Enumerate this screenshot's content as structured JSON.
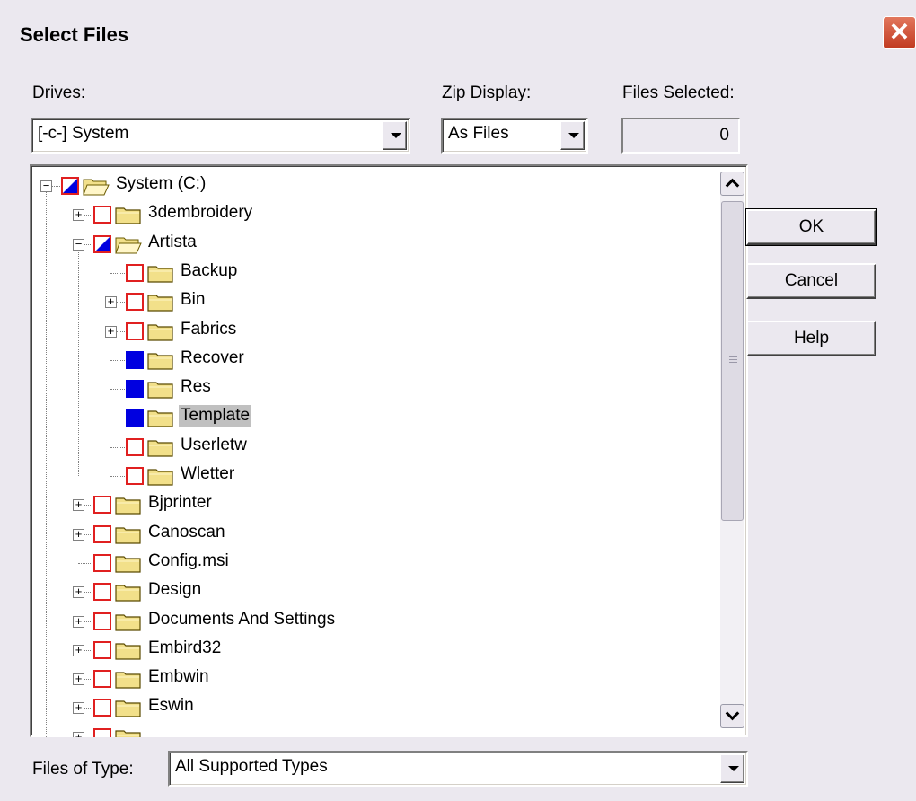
{
  "window": {
    "title": "Select Files",
    "close_glyph": "✕"
  },
  "drives": {
    "label": "Drives:",
    "value": "[-c-] System"
  },
  "zip_display": {
    "label": "Zip Display:",
    "value": "As Files"
  },
  "files_selected": {
    "label": "Files Selected:",
    "value": "0"
  },
  "buttons": {
    "ok": "OK",
    "cancel": "Cancel",
    "help": "Help"
  },
  "files_of_type": {
    "label": "Files of Type:",
    "value": "All Supported Types"
  },
  "tree": {
    "items": [
      {
        "label": "System (C:)",
        "level": 0,
        "expander": "minus",
        "check": "partial",
        "folder": "open"
      },
      {
        "label": "3dembroidery",
        "level": 1,
        "expander": "plus",
        "check": "none",
        "folder": "closed"
      },
      {
        "label": "Artista",
        "level": 1,
        "expander": "minus",
        "check": "partial",
        "folder": "open"
      },
      {
        "label": "Backup",
        "level": 2,
        "expander": "",
        "check": "none",
        "folder": "closed"
      },
      {
        "label": "Bin",
        "level": 2,
        "expander": "plus",
        "check": "none",
        "folder": "closed"
      },
      {
        "label": "Fabrics",
        "level": 2,
        "expander": "plus",
        "check": "none",
        "folder": "closed"
      },
      {
        "label": "Recover",
        "level": 2,
        "expander": "",
        "check": "full",
        "folder": "closed"
      },
      {
        "label": "Res",
        "level": 2,
        "expander": "",
        "check": "full",
        "folder": "closed"
      },
      {
        "label": "Template",
        "level": 2,
        "expander": "",
        "check": "full",
        "folder": "closed",
        "selected": true
      },
      {
        "label": "Userletw",
        "level": 2,
        "expander": "",
        "check": "none",
        "folder": "closed"
      },
      {
        "label": "Wletter",
        "level": 2,
        "expander": "",
        "check": "none",
        "folder": "closed"
      },
      {
        "label": "Bjprinter",
        "level": 1,
        "expander": "plus",
        "check": "none",
        "folder": "closed"
      },
      {
        "label": "Canoscan",
        "level": 1,
        "expander": "plus",
        "check": "none",
        "folder": "closed"
      },
      {
        "label": "Config.msi",
        "level": 1,
        "expander": "",
        "check": "none",
        "folder": "closed"
      },
      {
        "label": "Design",
        "level": 1,
        "expander": "plus",
        "check": "none",
        "folder": "closed"
      },
      {
        "label": "Documents And Settings",
        "level": 1,
        "expander": "plus",
        "check": "none",
        "folder": "closed"
      },
      {
        "label": "Embird32",
        "level": 1,
        "expander": "plus",
        "check": "none",
        "folder": "closed"
      },
      {
        "label": "Embwin",
        "level": 1,
        "expander": "plus",
        "check": "none",
        "folder": "closed"
      },
      {
        "label": "Eswin",
        "level": 1,
        "expander": "plus",
        "check": "none",
        "folder": "closed"
      },
      {
        "label": "",
        "level": 1,
        "expander": "plus",
        "check": "none",
        "folder": "closed"
      }
    ]
  },
  "colors": {
    "dialog_bg": "#ebe8ef",
    "check_full": "#0000e0",
    "check_border": "#e02020",
    "folder": "#f2e08a"
  },
  "icons": [
    "close-icon",
    "dropdown-arrow-icon",
    "folder-icon",
    "folder-open-icon",
    "checkbox-icon",
    "expander-icon",
    "scroll-up-icon",
    "scroll-down-icon"
  ]
}
